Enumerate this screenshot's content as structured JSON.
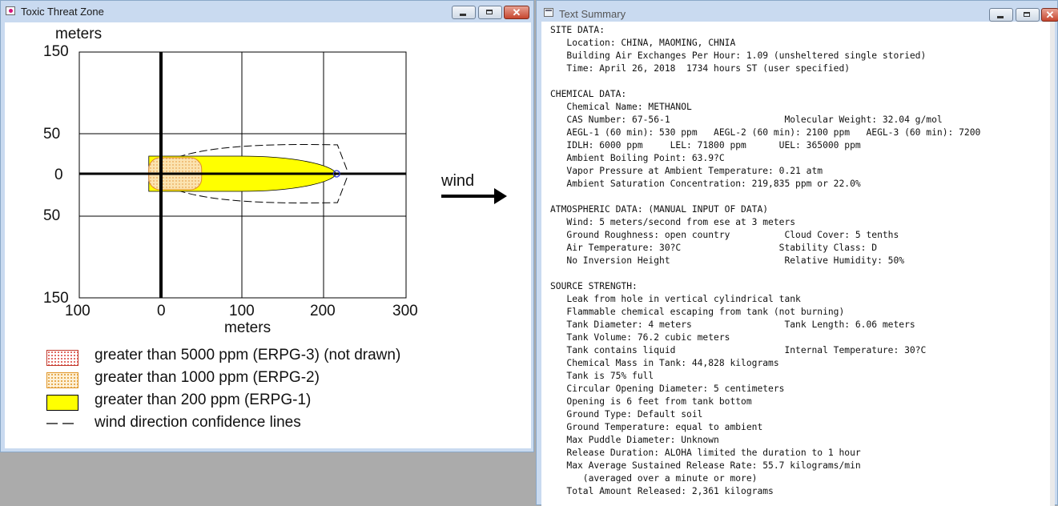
{
  "left_window": {
    "title": "Toxic Threat Zone",
    "close_symbol": "✕"
  },
  "right_window": {
    "title": "Text Summary",
    "close_symbol": "✕"
  },
  "chart_data": {
    "type": "threat-zone-plot",
    "y_axis": {
      "label": "meters",
      "ticks": [
        "150",
        "50",
        "0",
        "50",
        "150"
      ],
      "range": [
        -150,
        150
      ]
    },
    "x_axis": {
      "label": "meters",
      "ticks": [
        "100",
        "0",
        "100",
        "200",
        "300"
      ],
      "range": [
        -100,
        300
      ]
    },
    "wind_label": "wind",
    "zones": [
      {
        "name": "greater than 200 ppm (ERPG-1)",
        "x_min": -15,
        "x_max": 215,
        "half_width_max": 22,
        "color": "#ffff00"
      },
      {
        "name": "greater than 1000 ppm (ERPG-2)",
        "x_min": -15,
        "x_max": 50,
        "half_width_max": 20,
        "color": "#fbe3b0"
      }
    ],
    "confidence_lines": {
      "x_max": 222,
      "half_width_max": 38
    }
  },
  "legend": [
    {
      "label": "greater than 5000 ppm (ERPG-3) (not drawn)",
      "kind": "dotted-red"
    },
    {
      "label": "greater than 1000 ppm (ERPG-2)",
      "kind": "dotted-orange"
    },
    {
      "label": "greater than 200 ppm (ERPG-1)",
      "kind": "yellow"
    },
    {
      "label": "wind direction confidence lines",
      "kind": "dashed"
    }
  ],
  "summary_lines": [
    "SITE DATA:",
    "   Location: CHINA, MAOMING, CHNIA",
    "   Building Air Exchanges Per Hour: 1.09 (unsheltered single storied)",
    "   Time: April 26, 2018  1734 hours ST (user specified)",
    "",
    "CHEMICAL DATA:",
    "   Chemical Name: METHANOL",
    "   CAS Number: 67-56-1                     Molecular Weight: 32.04 g/mol",
    "   AEGL-1 (60 min): 530 ppm   AEGL-2 (60 min): 2100 ppm   AEGL-3 (60 min): 7200",
    "   IDLH: 6000 ppm     LEL: 71800 ppm      UEL: 365000 ppm",
    "   Ambient Boiling Point: 63.9?C",
    "   Vapor Pressure at Ambient Temperature: 0.21 atm",
    "   Ambient Saturation Concentration: 219,835 ppm or 22.0%",
    "",
    "ATMOSPHERIC DATA: (MANUAL INPUT OF DATA)",
    "   Wind: 5 meters/second from ese at 3 meters",
    "   Ground Roughness: open country          Cloud Cover: 5 tenths",
    "   Air Temperature: 30?C                  Stability Class: D",
    "   No Inversion Height                     Relative Humidity: 50%",
    "",
    "SOURCE STRENGTH:",
    "   Leak from hole in vertical cylindrical tank",
    "   Flammable chemical escaping from tank (not burning)",
    "   Tank Diameter: 4 meters                 Tank Length: 6.06 meters",
    "   Tank Volume: 76.2 cubic meters",
    "   Tank contains liquid                    Internal Temperature: 30?C",
    "   Chemical Mass in Tank: 44,828 kilograms",
    "   Tank is 75% full",
    "   Circular Opening Diameter: 5 centimeters",
    "   Opening is 6 feet from tank bottom",
    "   Ground Type: Default soil",
    "   Ground Temperature: equal to ambient",
    "   Max Puddle Diameter: Unknown",
    "   Release Duration: ALOHA limited the duration to 1 hour",
    "   Max Average Sustained Release Rate: 55.7 kilograms/min",
    "      (averaged over a minute or more)",
    "   Total Amount Released: 2,361 kilograms"
  ]
}
